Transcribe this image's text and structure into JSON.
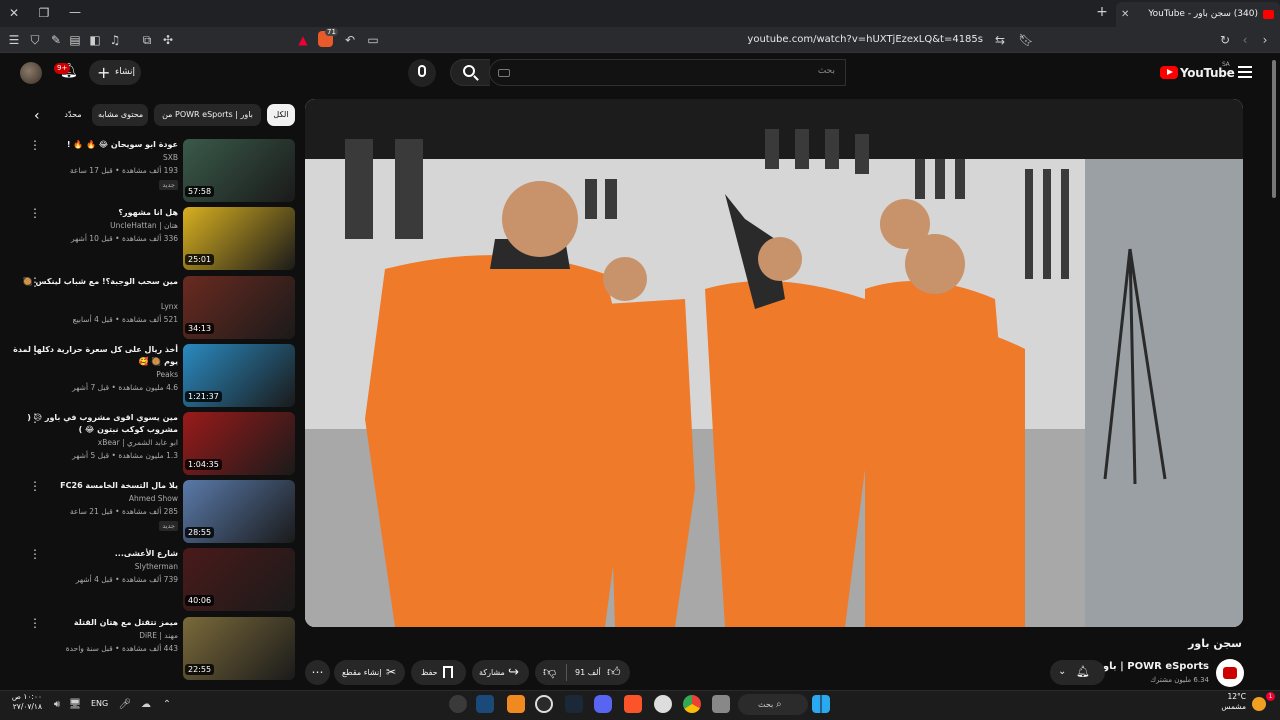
{
  "browser": {
    "tab_title": "(340) سجن باور - YouTube",
    "url": "youtube.com/watch?v=hUXTjEzexLQ&t=4185s",
    "shield_count": "71"
  },
  "header": {
    "logo_text": "YouTube",
    "country_code": "SA",
    "search_placeholder": "بحث",
    "create_label": "إنشاء",
    "notif_badge": "9+"
  },
  "chips": [
    "الكل",
    "من POWR eSports | باور",
    "محتوى مشابه",
    "محدّد"
  ],
  "recommendations": [
    {
      "title": "عودة ابو سويحان 😂 🔥 🔥 !",
      "channel": "SXB",
      "meta": "193 ألف مشاهدة • قبل 17 ساعة",
      "badge": "جديد",
      "duration": "57:58",
      "thumb": "#3a5a4a"
    },
    {
      "title": "هل انا مشهور؟",
      "channel": "هتان | UncleHattan",
      "meta": "336 ألف مشاهدة • قبل 10 أشهر",
      "badge": "",
      "duration": "25:01",
      "thumb": "#d8b020"
    },
    {
      "title": "مين سحب الوجبة؟! مع شباب لينكس 🥘",
      "channel": "Lynx",
      "meta": "521 ألف مشاهدة • قبل 4 أسابيع",
      "badge": "",
      "duration": "34:13",
      "thumb": "#6a2a20"
    },
    {
      "title": "أخذ ريال على كل سعرة حرارية دكلها لمدة يوم 🥘 🥰",
      "channel": "Peaks",
      "meta": "4.6 مليون مشاهدة • قبل 7 أشهر",
      "badge": "",
      "duration": "1:21:37",
      "thumb": "#2a8ac0"
    },
    {
      "title": "مين يسوي اقوى مشروب في باور 😥 ( مشروب كوكب نبتون 😂 )",
      "channel": "ابو عابد الشمري | xBear",
      "meta": "1.3 مليون مشاهدة • قبل 5 أشهر",
      "badge": "",
      "duration": "1:04:35",
      "thumb": "#9a1a1a"
    },
    {
      "title": "يلا مال التسخة الخامسة FC26",
      "channel": "Ahmed Show",
      "meta": "285 ألف مشاهدة • قبل 21 ساعة",
      "badge": "جديد",
      "duration": "28:55",
      "thumb": "#5a7aaa"
    },
    {
      "title": "شارع الأعشى...",
      "channel": "Slytherman",
      "meta": "739 ألف مشاهدة • قبل 4 أشهر",
      "badge": "",
      "duration": "40:06",
      "thumb": "#4a1a1a"
    },
    {
      "title": "ميمز تتقتل مع هتان القتلة",
      "channel": "مهند | DiRE",
      "meta": "443 ألف مشاهدة • قبل سنة واحدة",
      "badge": "",
      "duration": "22:55",
      "thumb": "#7a6a3a"
    }
  ],
  "video": {
    "title": "سجن باور",
    "channel": "POWR eSports | باور",
    "subscribers": "6.34 مليون مشترك",
    "likes": "91 ألف",
    "share_label": "مشاركة",
    "save_label": "حفظ",
    "clip_label": "إنشاء مقطع"
  },
  "taskbar": {
    "search_label": "بحث",
    "lang": "ENG",
    "time": "١٠:٠٠ ص",
    "date": "٢٧/٠٧/١٨",
    "temp": "12°C",
    "weather": "مشمس"
  }
}
